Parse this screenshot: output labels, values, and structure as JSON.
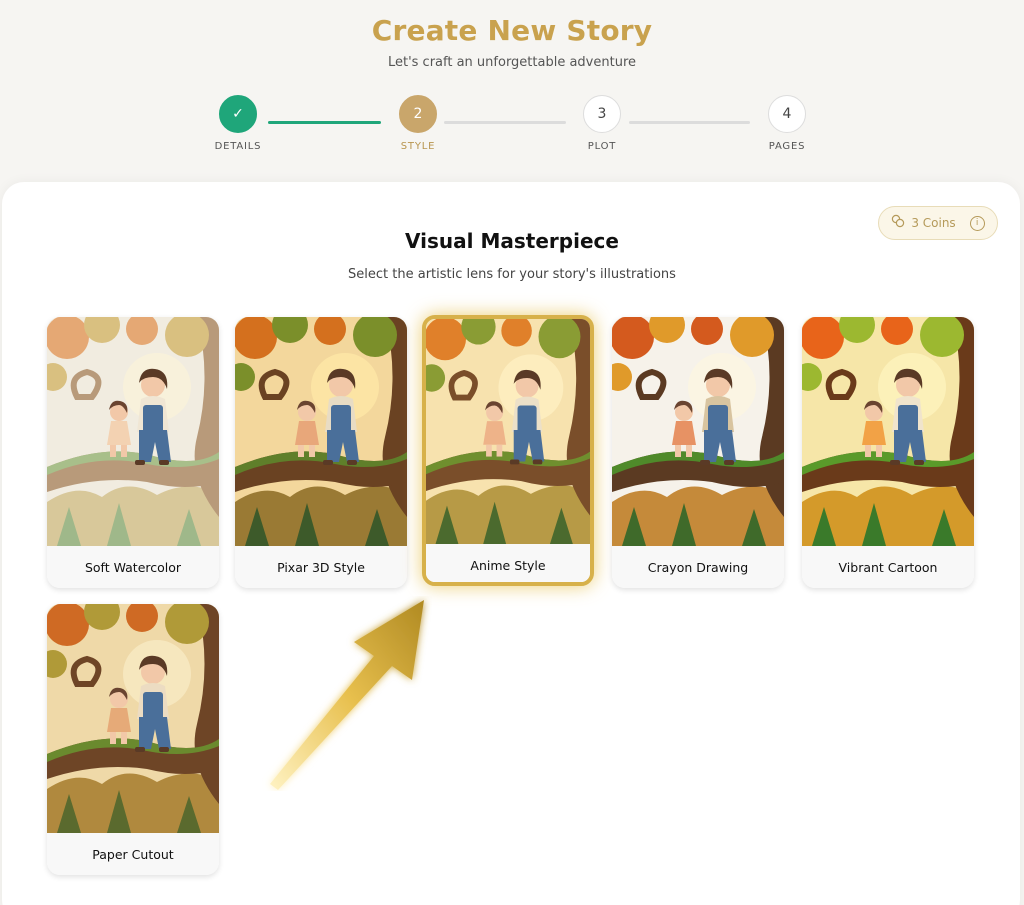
{
  "header": {
    "title": "Create New Story",
    "subtitle": "Let's craft an unforgettable adventure"
  },
  "stepper": {
    "steps": [
      {
        "indicator": "✓",
        "label": "DETAILS",
        "state": "done"
      },
      {
        "indicator": "2",
        "label": "STYLE",
        "state": "active"
      },
      {
        "indicator": "3",
        "label": "PLOT",
        "state": "upcoming"
      },
      {
        "indicator": "4",
        "label": "PAGES",
        "state": "upcoming"
      }
    ]
  },
  "coins": {
    "label": "3 Coins",
    "icon": "coins-icon",
    "info_icon": "info-icon"
  },
  "section": {
    "title": "Visual Masterpiece",
    "subtitle": "Select the artistic lens for your story's illustrations"
  },
  "styles": [
    {
      "label": "Soft Watercolor",
      "selected": false
    },
    {
      "label": "Pixar 3D Style",
      "selected": false
    },
    {
      "label": "Anime Style",
      "selected": true
    },
    {
      "label": "Crayon Drawing",
      "selected": false
    },
    {
      "label": "Vibrant Cartoon",
      "selected": false
    },
    {
      "label": "Paper Cutout",
      "selected": false
    }
  ],
  "colors": {
    "accent_gold": "#c9a24e",
    "done_green": "#1fa67a",
    "active_step": "#c9a66b",
    "selected_border": "#d7b14a"
  }
}
